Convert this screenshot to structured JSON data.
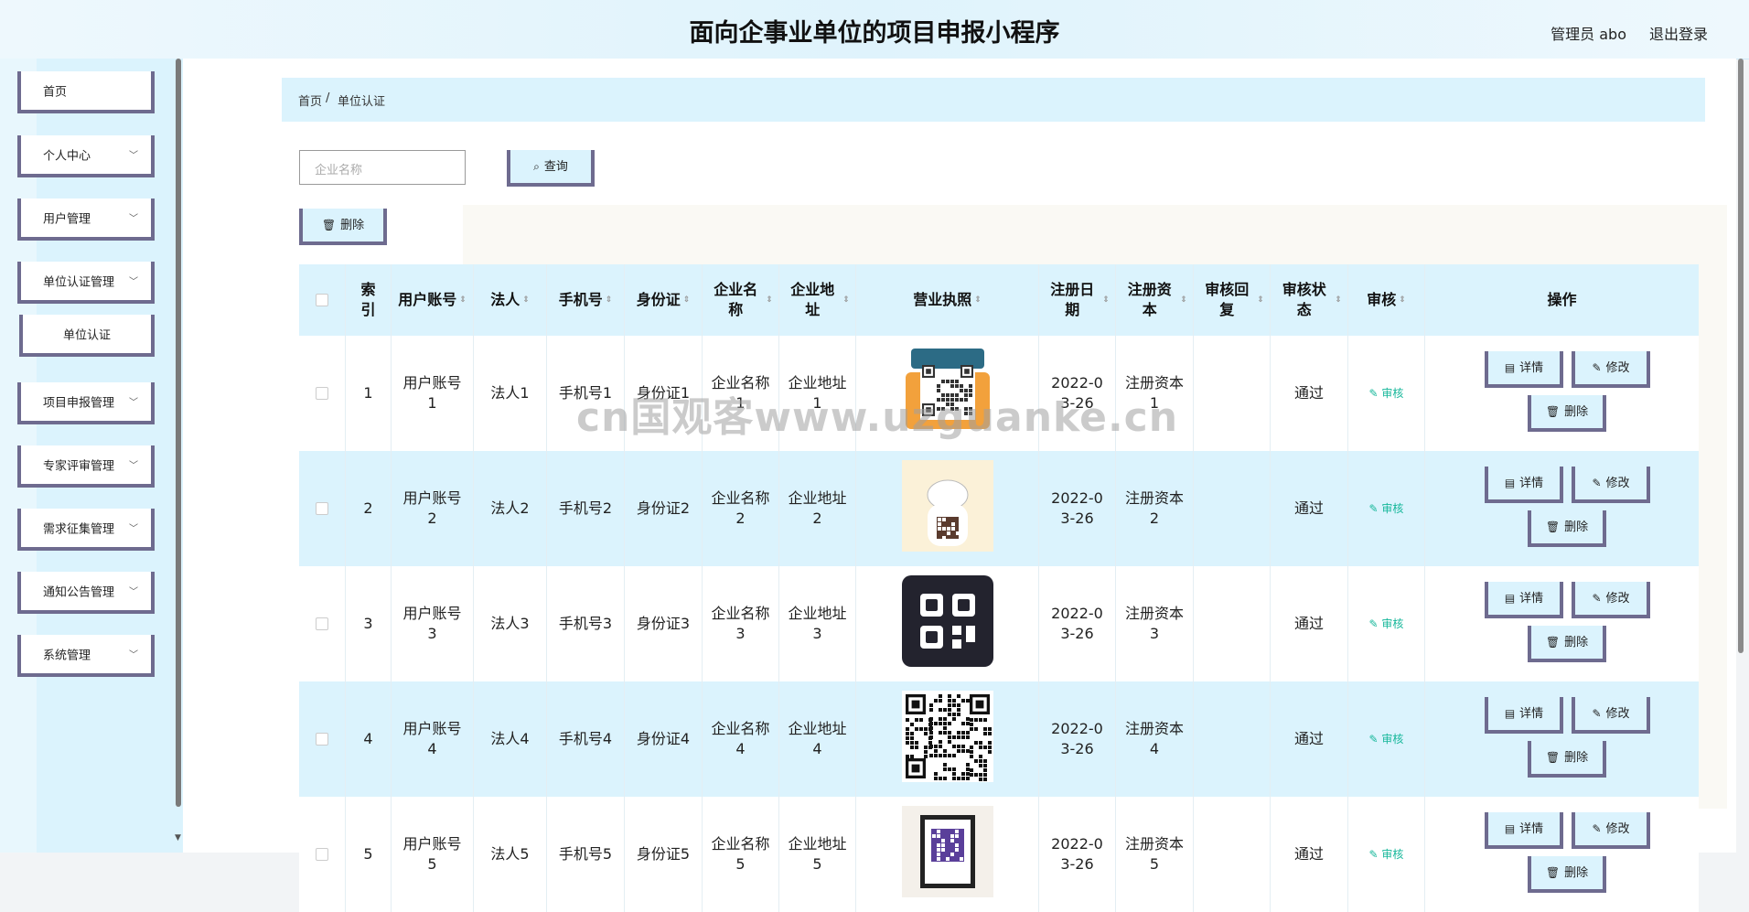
{
  "header": {
    "title": "面向企事业单位的项目申报小程序",
    "user": "管理员 abo",
    "logout": "退出登录"
  },
  "sidebar": {
    "items": [
      {
        "label": "首页",
        "has_chevron": false
      },
      {
        "label": "个人中心",
        "has_chevron": true
      },
      {
        "label": "用户管理",
        "has_chevron": true
      },
      {
        "label": "单位认证管理",
        "has_chevron": true
      },
      {
        "label": "单位认证",
        "has_chevron": false
      },
      {
        "label": "项目申报管理",
        "has_chevron": true
      },
      {
        "label": "专家评审管理",
        "has_chevron": true
      },
      {
        "label": "需求征集管理",
        "has_chevron": true
      },
      {
        "label": "通知公告管理",
        "has_chevron": true
      },
      {
        "label": "系统管理",
        "has_chevron": true
      }
    ]
  },
  "breadcrumb": {
    "home": "首页",
    "sep": "/",
    "current": "单位认证"
  },
  "search": {
    "placeholder": "企业名称",
    "button": "查询",
    "search_icon": "search-icon"
  },
  "toolbar": {
    "delete": "删除",
    "delete_icon": "trash-icon"
  },
  "table": {
    "headers": [
      "索引",
      "用户账号",
      "法人",
      "手机号",
      "身份证",
      "企业名称",
      "企业地址",
      "营业执照",
      "注册日期",
      "注册资本",
      "审核回复",
      "审核状态",
      "审核",
      "操作"
    ],
    "rows": [
      {
        "index": "1",
        "account": "用户账号1",
        "legal": "法人1",
        "phone": "手机号1",
        "id_card": "身份证1",
        "company": "企业名称1",
        "address": "企业地址1",
        "license": "qr-poster",
        "date": "2022-03-26",
        "capital": "注册资本1",
        "reply": "",
        "status": "通过",
        "audit": "审核"
      },
      {
        "index": "2",
        "account": "用户账号2",
        "legal": "法人2",
        "phone": "手机号2",
        "id_card": "身份证2",
        "company": "企业名称2",
        "address": "企业地址2",
        "license": "qr-cartoon",
        "date": "2022-03-26",
        "capital": "注册资本2",
        "reply": "",
        "status": "通过",
        "audit": "审核"
      },
      {
        "index": "3",
        "account": "用户账号3",
        "legal": "法人3",
        "phone": "手机号3",
        "id_card": "身份证3",
        "company": "企业名称3",
        "address": "企业地址3",
        "license": "qr-dark-icon",
        "date": "2022-03-26",
        "capital": "注册资本3",
        "reply": "",
        "status": "通过",
        "audit": "审核"
      },
      {
        "index": "4",
        "account": "用户账号4",
        "legal": "法人4",
        "phone": "手机号4",
        "id_card": "身份证4",
        "company": "企业名称4",
        "address": "企业地址4",
        "license": "qr-code",
        "date": "2022-03-26",
        "capital": "注册资本4",
        "reply": "",
        "status": "通过",
        "audit": "审核"
      },
      {
        "index": "5",
        "account": "用户账号5",
        "legal": "法人5",
        "phone": "手机号5",
        "id_card": "身份证5",
        "company": "企业名称5",
        "address": "企业地址5",
        "license": "qr-frame",
        "date": "2022-03-26",
        "capital": "注册资本5",
        "reply": "",
        "status": "通过",
        "audit": "审核"
      }
    ],
    "actions": {
      "detail": "详情",
      "edit": "修改",
      "delete": "删除"
    }
  },
  "watermark": "cn国观客www.uzguanke.cn",
  "colors": {
    "accent_bg": "#dbf3fd",
    "button_border": "#6e6b8f",
    "audit_green": "#16b79a"
  }
}
